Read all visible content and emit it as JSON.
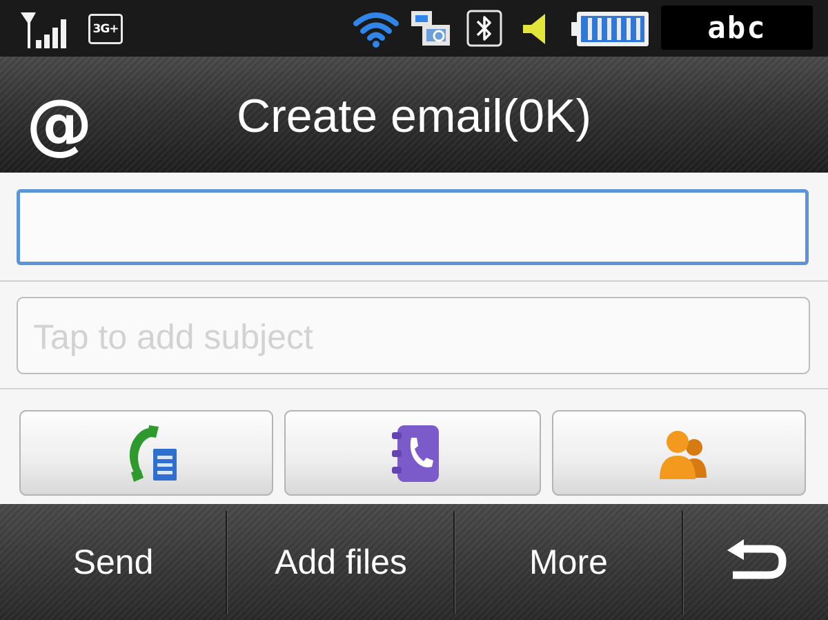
{
  "status_bar": {
    "network_badge": "3G+",
    "input_mode": "abc",
    "icons": [
      "signal-icon",
      "3g-plus-icon",
      "wifi-icon",
      "sync-icon",
      "bluetooth-icon",
      "volume-icon",
      "battery-icon"
    ]
  },
  "header": {
    "icon": "at-sign-icon",
    "title": "Create email(0K)"
  },
  "compose": {
    "to_value": "",
    "subject_placeholder": "Tap to add subject"
  },
  "quick_buttons": [
    {
      "icon": "call-log-icon",
      "color": "#2e9a2e"
    },
    {
      "icon": "phonebook-icon",
      "color": "#7b5bc9"
    },
    {
      "icon": "contacts-group-icon",
      "color": "#f39a1e"
    }
  ],
  "softkeys": {
    "send": "Send",
    "add_files": "Add files",
    "more": "More",
    "back_icon": "back-arrow-icon"
  },
  "colors": {
    "focus_border": "#5b95d8",
    "bar_background": "#3a3a3a"
  }
}
